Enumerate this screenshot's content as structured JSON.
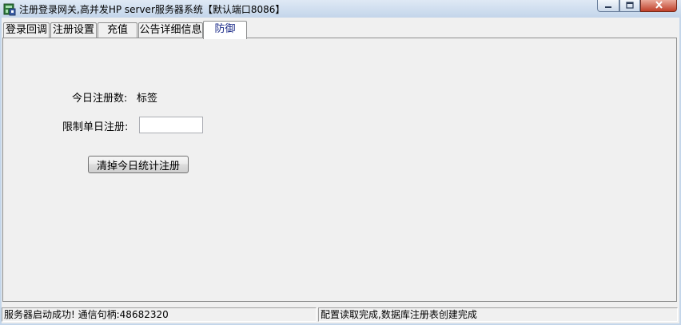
{
  "window": {
    "title": "注册登录网关,高并发HP server服务器系统【默认端口8086】"
  },
  "tabs": [
    {
      "label": "登录回调",
      "active": false
    },
    {
      "label": "注册设置",
      "active": false
    },
    {
      "label": "充值",
      "active": false
    },
    {
      "label": "公告详细信息",
      "active": false
    },
    {
      "label": "防御",
      "active": true
    }
  ],
  "panel": {
    "today_registrations_label": "今日注册数:",
    "today_registrations_value": "标签",
    "daily_limit_label": "限制单日注册:",
    "daily_limit_value": "",
    "clear_button_label": "清掉今日统计注册"
  },
  "statusbar": {
    "left": "服务器启动成功! 通信句柄:48682320",
    "right": "配置读取完成,数据库注册表创建完成"
  },
  "colors": {
    "active_tab_text": "#1a2a88",
    "close_button": "#c0402a",
    "window_background": "#f0f0f0"
  }
}
